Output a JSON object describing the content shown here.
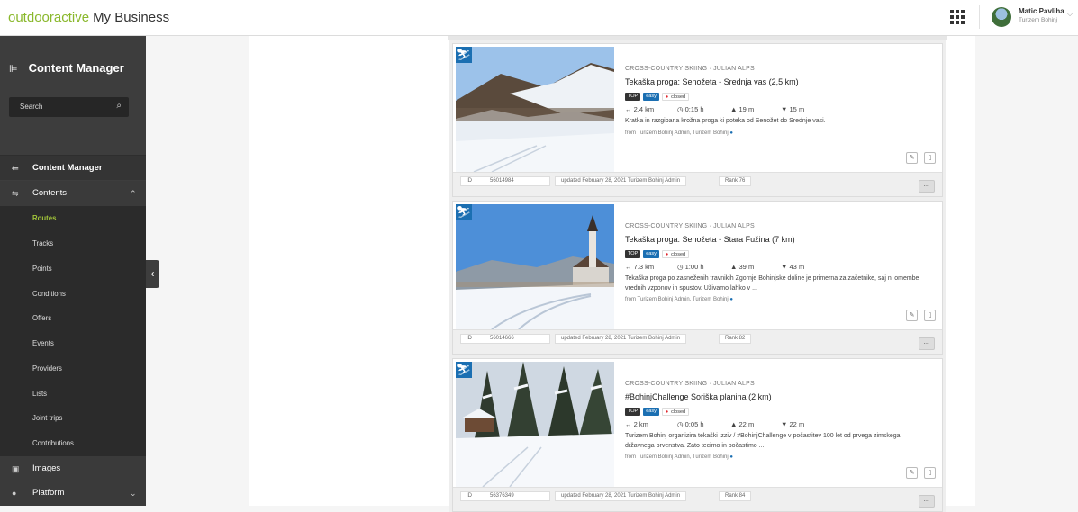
{
  "brand": {
    "part1": "outdooractive",
    "part2": "My Business"
  },
  "header": {
    "apps_icon": "grid-icon",
    "user_name": "Matic Pavliha",
    "user_org": "Turizem Bohinj"
  },
  "sidebar": {
    "title": "Content Manager",
    "search_placeholder": "Search",
    "sections": [
      {
        "label": "Content Manager",
        "icon": "arrow-left-icon"
      },
      {
        "label": "Contents",
        "icon": "contents-icon",
        "expanded": true
      },
      {
        "label": "Images",
        "icon": "image-icon"
      },
      {
        "label": "Platform",
        "icon": "globe-icon"
      }
    ],
    "sub_items": [
      "Routes",
      "Tracks",
      "Points",
      "Conditions",
      "Offers",
      "Events",
      "Providers",
      "Lists",
      "Joint trips",
      "Contributions"
    ],
    "active_sub": "Routes"
  },
  "cards": [
    {
      "category": "CROSS-COUNTRY SKIING · JULIAN ALPS",
      "title": "Tekaška proga: Senožeta - Srednja vas (2,5 km)",
      "badges": [
        "TOP",
        "easy",
        "closed"
      ],
      "distance": "2.4 km",
      "duration": "0:15 h",
      "ascent": "19 m",
      "descent": "15 m",
      "description": "Kratka in razgibana krožna proga ki poteka od Senožet do Srednje vasi.",
      "from": "from Turizem Bohinj Admin, Turizem Bohinj",
      "id_label": "ID",
      "id": "56014984",
      "updated": "updated   February 28, 2021 Turizem Bohinj Admin",
      "rank": "Rank   76"
    },
    {
      "category": "CROSS-COUNTRY SKIING · JULIAN ALPS",
      "title": "Tekaška proga: Senožeta - Stara Fužina (7 km)",
      "badges": [
        "TOP",
        "easy",
        "closed"
      ],
      "distance": "7.3 km",
      "duration": "1:00 h",
      "ascent": "39 m",
      "descent": "43 m",
      "description": "Tekaška proga po zasneženih travnikih Zgornje Bohinjske doline je primerna za začetnike, saj ni omembe vrednih vzponov in spustov. Uživamo lahko v ...",
      "from": "from Turizem Bohinj Admin, Turizem Bohinj",
      "id_label": "ID",
      "id": "56014666",
      "updated": "updated   February 28, 2021 Turizem Bohinj Admin",
      "rank": "Rank   82"
    },
    {
      "category": "CROSS-COUNTRY SKIING · JULIAN ALPS",
      "title": "#BohinjChallenge Soriška planina (2 km)",
      "badges": [
        "TOP",
        "easy",
        "closed"
      ],
      "distance": "2 km",
      "duration": "0:05 h",
      "ascent": "22 m",
      "descent": "22 m",
      "description": "Turizem Bohinj organizira tekaški izziv / #BohinjChallenge v počastitev 100 let od prvega zimskega državnega prvenstva. Zato tecimo in počastimo ...",
      "from": "from Turizem Bohinj Admin, Turizem Bohinj",
      "id_label": "ID",
      "id": "56376349",
      "updated": "updated   February 28, 2021 Turizem Bohinj Admin",
      "rank": "Rank   84"
    }
  ],
  "colors": {
    "brand_green": "#8ab82c",
    "sidebar": "#3d3d3d",
    "active": "#a2c43a",
    "easy_badge": "#1b6fb2",
    "closed_dot": "#e0262d"
  }
}
